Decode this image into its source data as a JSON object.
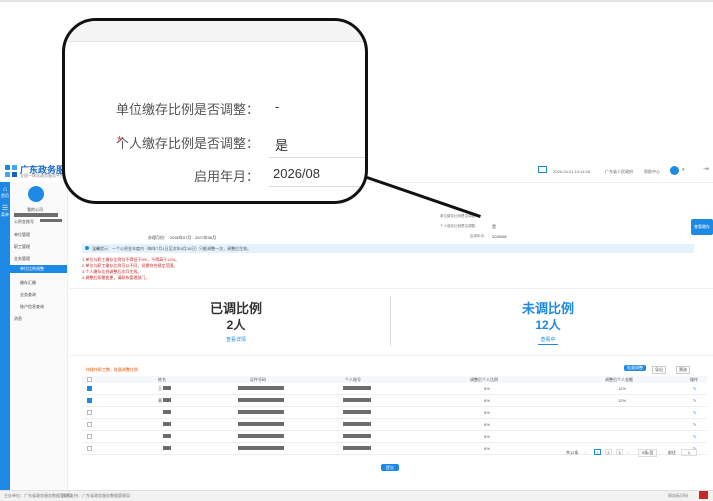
{
  "header": {
    "app_title": "广东政务服",
    "app_subtitle": "全国一体化政务服务平台",
    "datetime": "2026-04-01 10:14:16",
    "user_text": "广东省人民政府",
    "help_center": "帮助中心"
  },
  "rail": {
    "home": "首页",
    "menu": "菜单"
  },
  "sidebar": {
    "company": "我的公司",
    "account_label": "公积金账号",
    "items": [
      {
        "label": "单位管理"
      },
      {
        "label": "职工管理"
      },
      {
        "label": "业务管理"
      },
      {
        "label": "单位比例调整"
      },
      {
        "label": "缴存汇缴"
      },
      {
        "label": "业务查询"
      },
      {
        "label": "账户信息查询"
      },
      {
        "label": "消息"
      }
    ]
  },
  "form": {
    "period_label": "办理月份：",
    "period_value": "2026年07月 - 2027年06月",
    "unit_ratio_label": "单位缴存比例是否调整：",
    "unit_ratio_value": "-",
    "personal_ratio_label": "个人缴存比例是否调整：",
    "personal_ratio_value": "是",
    "start_month_label": "启用年月：",
    "start_month_value": "2026/08",
    "side_button": "查看缴存"
  },
  "notice": {
    "info": "温馨提示：一个公积金年度内（每年7月1日至次年6月30日）只能调整一次，调整后生效。",
    "lines": [
      "1.单位与职工缴存比例均不得低于5%，不得高于12%。",
      "2.单位与职工缴存比例可以不同，但需符合规定范围。",
      "3.个人缴存比例调整后次月生效。",
      "4.调整后如需变更，请联系管理部门。"
    ]
  },
  "stats": {
    "adjusted_label": "已调比例",
    "adjusted_value": "2人",
    "adjusted_link": "查看详情",
    "unadjusted_label": "未调比例",
    "unadjusted_value": "12人",
    "unadjusted_link": "查看中"
  },
  "table": {
    "toolbar_note": "待操作职工数，批量调整比例",
    "batch_button": "批量调整",
    "export_button": "导出",
    "filter_button": "筛选",
    "columns": [
      "姓名",
      "证件号码",
      "个人账号",
      "调整后个人比例",
      "调整后个人金额",
      "操作"
    ],
    "rows": [
      {
        "name": "王",
        "ratio": "8%",
        "amount": "12%",
        "checked": true
      },
      {
        "name": "黄",
        "ratio": "8%",
        "amount": "12%",
        "checked": true
      },
      {
        "name": "",
        "ratio": "8%",
        "amount": "",
        "checked": false
      },
      {
        "name": "",
        "ratio": "8%",
        "amount": "",
        "checked": false
      },
      {
        "name": "",
        "ratio": "8%",
        "amount": "",
        "checked": false
      },
      {
        "name": "",
        "ratio": "8%",
        "amount": "",
        "checked": false
      }
    ],
    "pagination": {
      "total": "共12条",
      "pages": [
        "1",
        "2",
        "3"
      ],
      "page_size": "5条/页",
      "goto": "前往",
      "goto_page": "1"
    },
    "submit": "提交"
  },
  "footer": {
    "left1": "主办单位：广东省政务服务数据管理局",
    "left2": "技术支持：广东省政务服务数据管理局",
    "right": "网站标识码"
  }
}
